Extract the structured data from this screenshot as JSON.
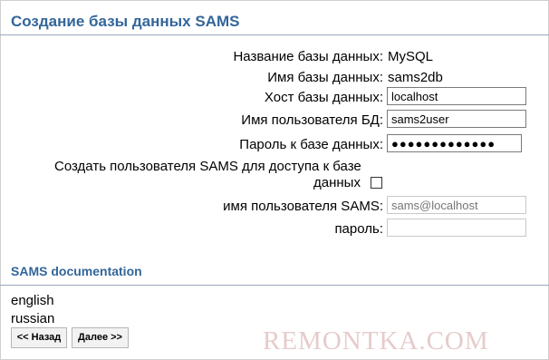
{
  "page": {
    "title": "Создание базы данных SAMS"
  },
  "db_form": {
    "db_name_label": "Название базы данных:",
    "db_name_value": "MySQL",
    "db_schema_label": "Имя базы данных:",
    "db_schema_value": "sams2db",
    "host_label": "Хост базы данных:",
    "host_value": "localhost",
    "user_label": "Имя пользователя БД:",
    "user_value": "sams2user",
    "password_label": "Пароль к базе данных:",
    "password_value": "●●●●●●●●●●●●●",
    "create_user_label_line1": "Создать пользователя SAMS для доступа к базе",
    "create_user_label_line2": "данных",
    "create_user_checked": false,
    "sams_user_label": "имя пользователя SAMS:",
    "sams_user_placeholder": "sams@localhost",
    "sams_password_label": "пароль:",
    "sams_password_value": ""
  },
  "docs": {
    "title": "SAMS documentation",
    "links": [
      "english",
      "russian"
    ]
  },
  "nav": {
    "back_label": "<< Назад",
    "next_label": "Далее >>"
  },
  "watermark": "REMONTKA.COM"
}
